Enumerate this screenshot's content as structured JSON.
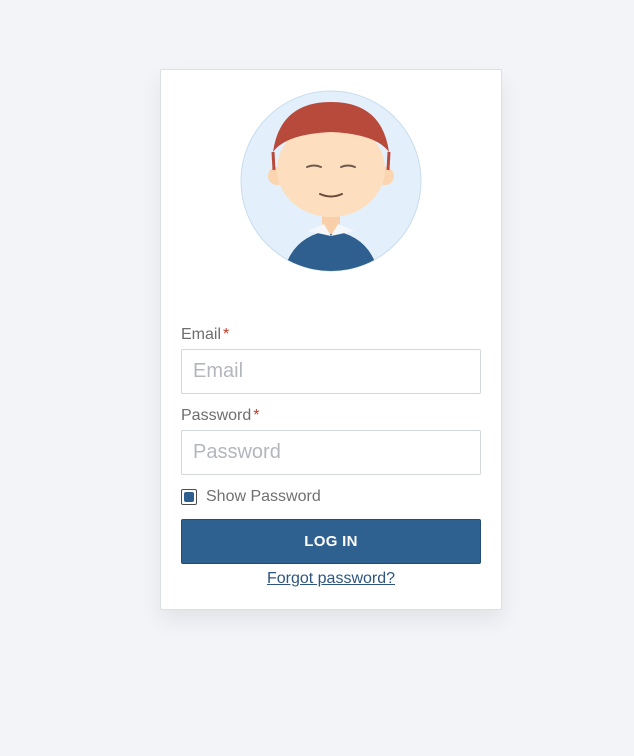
{
  "login_form": {
    "email_label": "Email",
    "email_required_mark": "*",
    "email_placeholder": "Email",
    "email_value": "",
    "password_label": "Password",
    "password_required_mark": "*",
    "password_placeholder": "Password",
    "password_value": "",
    "show_password_label": "Show Password",
    "show_password_checked": true,
    "login_button_label": "LOG IN",
    "forgot_password_link": "Forgot password?"
  },
  "avatar": {
    "icon": "user-avatar-icon"
  },
  "colors": {
    "page_background": "#f2f4f8",
    "primary": "#2e6090",
    "link": "#2e5580",
    "required_mark": "#c0392b",
    "avatar_background": "#e3f0fc",
    "avatar_hair": "#b84a3c",
    "avatar_skin": "#fddfc0",
    "avatar_shirt": "#2e5f8f"
  }
}
